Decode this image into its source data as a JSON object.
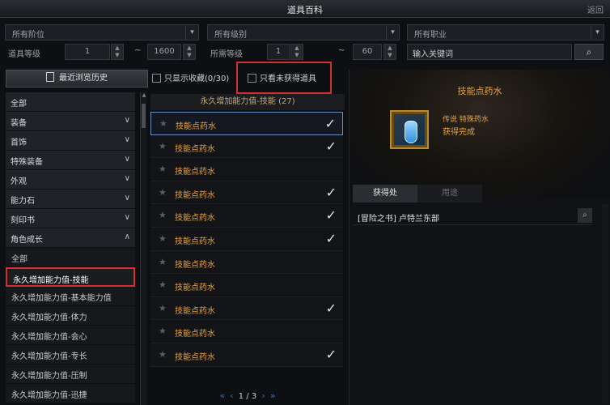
{
  "window": {
    "title": "道具百科",
    "corner_button": "返回"
  },
  "filters": {
    "tier_select": "所有阶位",
    "grade_select": "所有级别",
    "class_select": "所有职业",
    "item_level_label": "道具等级",
    "item_level_min": "1",
    "item_level_max": "1600",
    "req_level_label": "所需等级",
    "req_level_min": "1",
    "req_level_max": "60",
    "range_sep": "~",
    "keyword_placeholder": "输入关键词"
  },
  "left_panel": {
    "recent_button": "最近浏览历史",
    "categories": [
      "全部",
      "装备",
      "首饰",
      "特殊装备",
      "外观",
      "能力石",
      "刻印书",
      "角色成长"
    ],
    "subcategories": [
      "全部",
      "永久增加能力值-技能",
      "永久增加能力值-基本能力值",
      "永久增加能力值-体力",
      "永久增加能力值-会心",
      "永久增加能力值-专长",
      "永久增加能力值-压制",
      "永久增加能力值-迅捷"
    ]
  },
  "middle_panel": {
    "show_favorites": "只显示收藏(0/30)",
    "show_unobtained": "只看未获得道具",
    "group_header": "永久增加能力值-技能 (27)",
    "items": [
      {
        "name": "技能点药水",
        "obtained": true
      },
      {
        "name": "技能点药水",
        "obtained": true
      },
      {
        "name": "技能点药水",
        "obtained": false
      },
      {
        "name": "技能点药水",
        "obtained": true
      },
      {
        "name": "技能点药水",
        "obtained": true
      },
      {
        "name": "技能点药水",
        "obtained": true
      },
      {
        "name": "技能点药水",
        "obtained": false
      },
      {
        "name": "技能点药水",
        "obtained": false
      },
      {
        "name": "技能点药水",
        "obtained": true
      },
      {
        "name": "技能点药水",
        "obtained": false
      },
      {
        "name": "技能点药水",
        "obtained": true
      }
    ],
    "page": "1 / 3"
  },
  "detail_panel": {
    "item_name": "技能点药水",
    "rarity": "传说 特殊药水",
    "status": "获得完成",
    "tab_source": "获得处",
    "tab_usage": "用途",
    "source_entry": "[冒险之书] 卢特兰东部"
  },
  "colors": {
    "accent_orange": "#e8a33a",
    "highlight_red": "#d0302e",
    "select_blue": "#6a8fbf"
  }
}
